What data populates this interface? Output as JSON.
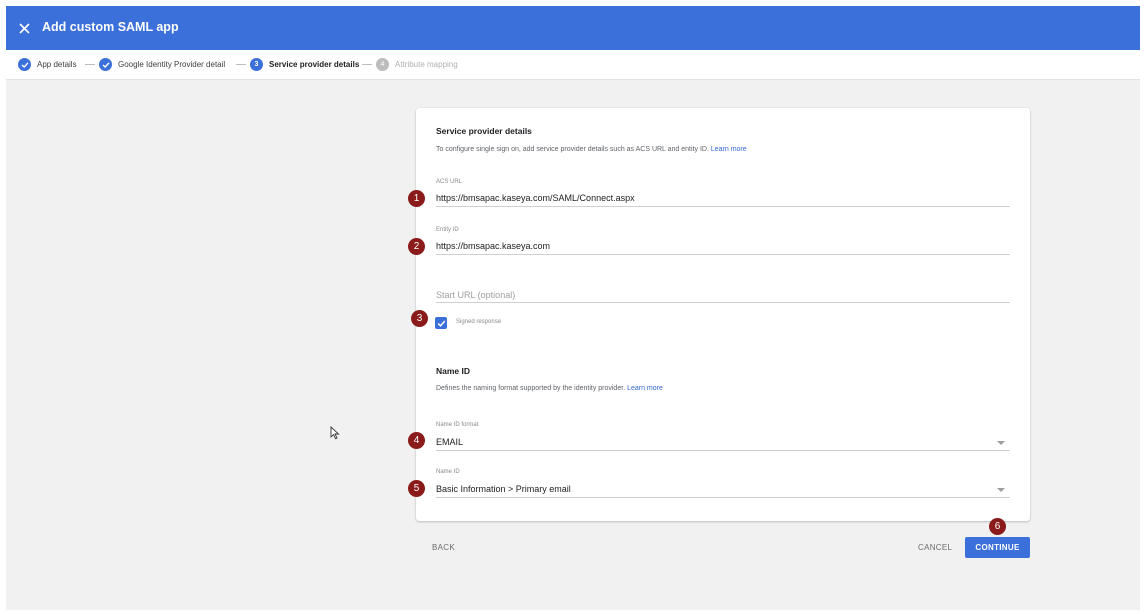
{
  "window": {
    "title": "Add custom SAML app"
  },
  "stepper": {
    "steps": [
      {
        "label": "App details",
        "status": "done",
        "badge": ""
      },
      {
        "label": "Google Identity Provider detail",
        "status": "done",
        "badge": ""
      },
      {
        "label": "Service provider details",
        "status": "active",
        "badge": "3"
      },
      {
        "label": "Attribute mapping",
        "status": "pending",
        "badge": "4"
      }
    ]
  },
  "card": {
    "section_title": "Service provider details",
    "section_desc": "To configure single sign on, add service provider details such as ACS URL and entity ID.",
    "learn_more": "Learn more",
    "acs": {
      "label": "ACS URL",
      "value": "https://bmsapac.kaseya.com/SAML/Connect.aspx"
    },
    "entity": {
      "label": "Entity ID",
      "value": "https://bmsapac.kaseya.com"
    },
    "start_url": {
      "placeholder": "Start URL (optional)"
    },
    "signed_response": {
      "label": "Signed response",
      "checked": true
    },
    "nameid_section": {
      "title": "Name ID",
      "desc": "Defines the naming format supported by the identity provider.",
      "learn_more": "Learn more"
    },
    "nameid_format": {
      "label": "Name ID format",
      "value": "EMAIL"
    },
    "nameid": {
      "label": "Name ID",
      "value": "Basic Information > Primary email"
    }
  },
  "footer": {
    "back": "BACK",
    "cancel": "CANCEL",
    "continue": "CONTINUE"
  },
  "markers": [
    "1",
    "2",
    "3",
    "4",
    "5",
    "6"
  ],
  "colors": {
    "primary": "#3b6fd9",
    "marker": "#8b1a1a",
    "link": "#3367d6"
  }
}
